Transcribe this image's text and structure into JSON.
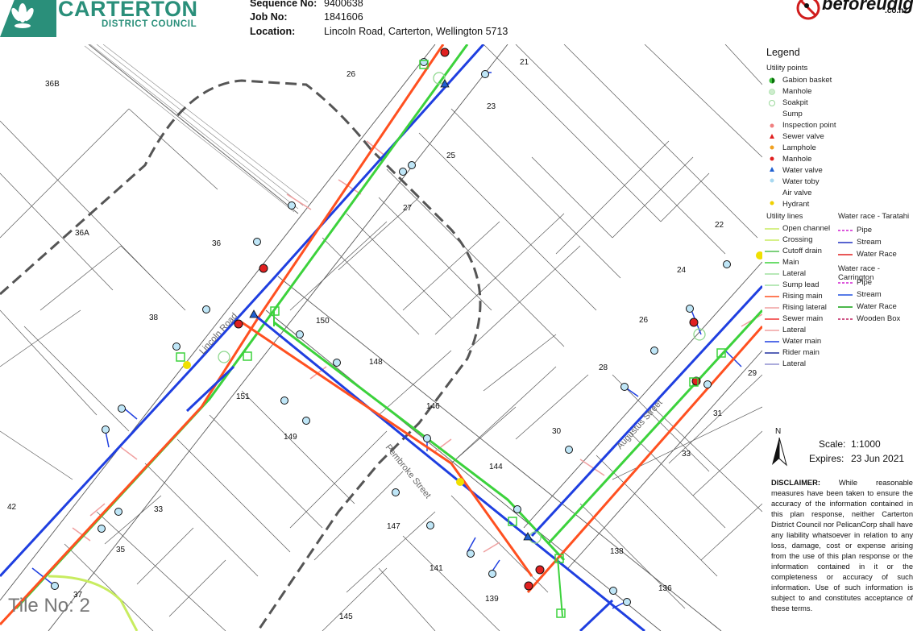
{
  "header": {
    "council_name": "CARTERTON",
    "council_sub": "DISTRICT COUNCIL",
    "sequence_label": "Sequence No:",
    "sequence_value": "9400638",
    "job_label": "Job No:",
    "job_value": "1841606",
    "location_label": "Location:",
    "location_value": "Lincoln Road, Carterton, Wellington  5713",
    "bud_logo": "beforeudig",
    "bud_domain": ".co.nz"
  },
  "map": {
    "street_names": [
      "Lincoln Road",
      "Pembroke Street",
      "Augustus Street"
    ],
    "parcel_labels": [
      "36B",
      "26",
      "21",
      "23",
      "25",
      "27",
      "36A",
      "36",
      "22",
      "24",
      "150",
      "38",
      "148",
      "26",
      "28",
      "29",
      "151",
      "146",
      "31",
      "149",
      "30",
      "33",
      "144",
      "42",
      "33",
      "147",
      "138",
      "35",
      "141",
      "37",
      "139",
      "136",
      "145"
    ],
    "tile_label": "Tile No: 2"
  },
  "legend": {
    "title": "Legend",
    "utility_points_heading": "Utility points",
    "utility_points": [
      {
        "label": "Gabion basket",
        "color": "#3cbf3c",
        "icon": "half-circle-icon"
      },
      {
        "label": "Manhole",
        "color": "#b0e4b0",
        "icon": "circle-icon"
      },
      {
        "label": "Soakpit",
        "color": "#b0e4b0",
        "icon": "circle-outline-icon"
      },
      {
        "label": "Sump",
        "color": "#ffffff",
        "icon": "none"
      },
      {
        "label": "Inspection point",
        "color": "#f08080",
        "icon": "dot-icon"
      },
      {
        "label": "Sewer valve",
        "color": "#e02020",
        "icon": "triangle-icon"
      },
      {
        "label": "Lamphole",
        "color": "#f0a020",
        "icon": "dot-icon"
      },
      {
        "label": "Manhole",
        "color": "#e02020",
        "icon": "dot-icon"
      },
      {
        "label": "Water valve",
        "color": "#1f5fd0",
        "icon": "triangle-icon"
      },
      {
        "label": "Water toby",
        "color": "#a8d8f0",
        "icon": "dot-icon"
      },
      {
        "label": "Air valve",
        "color": "#ffffff",
        "icon": "none"
      },
      {
        "label": "Hydrant",
        "color": "#f0d000",
        "icon": "dot-icon"
      }
    ],
    "utility_lines_heading": "Utility lines",
    "utility_lines": [
      {
        "label": "Open channel",
        "color": "#c8ec60"
      },
      {
        "label": "Crossing",
        "color": "#c8ec60"
      },
      {
        "label": "Cutoff drain",
        "color": "#50c050"
      },
      {
        "label": "Main",
        "color": "#3cd23c"
      },
      {
        "label": "Lateral",
        "color": "#a0e0a0"
      },
      {
        "label": "Sump lead",
        "color": "#a0e0a0"
      },
      {
        "label": "Rising main",
        "color": "#ff5020"
      },
      {
        "label": "Rising lateral",
        "color": "#f0a0a0"
      },
      {
        "label": "Sewer main",
        "color": "#f03030"
      },
      {
        "label": "Lateral",
        "color": "#f0a0a0"
      },
      {
        "label": "Water main",
        "color": "#1f3fe0"
      },
      {
        "label": "Rider main",
        "color": "#2030a0"
      },
      {
        "label": "Lateral",
        "color": "#9090d0"
      }
    ],
    "water_race_taratahi_heading": "Water race - Taratahi",
    "water_race_taratahi": [
      {
        "label": "Pipe",
        "color": "#d020d0",
        "style": "dashed"
      },
      {
        "label": "Stream",
        "color": "#2030c0",
        "style": "solid"
      },
      {
        "label": "Water Race",
        "color": "#e02020",
        "style": "solid"
      }
    ],
    "water_race_carrington_heading": "Water race - Carrington",
    "water_race_carrington": [
      {
        "label": "Pipe",
        "color": "#d020d0",
        "style": "dashed"
      },
      {
        "label": "Stream",
        "color": "#2050e0",
        "style": "solid"
      },
      {
        "label": "Water Race",
        "color": "#10a010",
        "style": "solid"
      },
      {
        "label": "Wooden Box",
        "color": "#c02060",
        "style": "dashed"
      }
    ]
  },
  "scale_panel": {
    "north": "N",
    "scale_label": "Scale:",
    "scale_value": "1:1000",
    "expires_label": "Expires:",
    "expires_value": "23 Jun 2021"
  },
  "disclaimer": {
    "heading": "DISCLAIMER:",
    "text": "While reasonable measures have been taken to ensure the accuracy of the information contained in this plan response, neither Carterton District Council nor PelicanCorp shall have any liability whatsoever in relation to any loss, damage, cost or expense arising from the use of this plan response or the information contained in it or the completeness or accuracy of such information. Use of such information is subject to and constitutes acceptance of these terms."
  }
}
